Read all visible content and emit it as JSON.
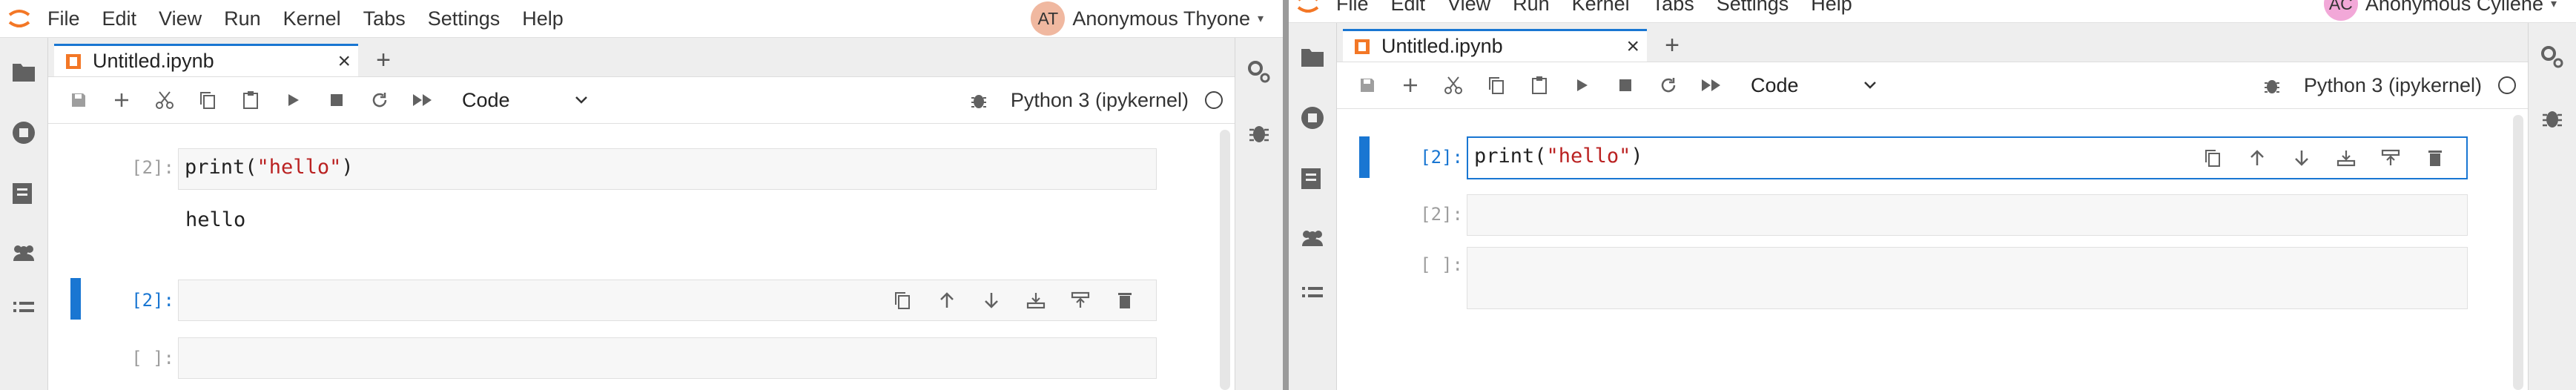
{
  "left": {
    "menu": [
      "File",
      "Edit",
      "View",
      "Run",
      "Kernel",
      "Tabs",
      "Settings",
      "Help"
    ],
    "user": {
      "initials": "AT",
      "name": "Anonymous Thyone",
      "avatar_color": "#f0b8a0"
    },
    "tab": {
      "title": "Untitled.ipynb"
    },
    "toolbar": {
      "cell_type": "Code",
      "kernel": "Python 3 (ipykernel)"
    },
    "cells": [
      {
        "prompt": "[2]:",
        "code_fn": "print(",
        "code_str": "\"hello\"",
        "code_end": ")",
        "output": "hello"
      },
      {
        "prompt": "[2]:"
      },
      {
        "prompt": "[ ]:"
      }
    ]
  },
  "right": {
    "menu": [
      "File",
      "Edit",
      "View",
      "Run",
      "Kernel",
      "Tabs",
      "Settings",
      "Help"
    ],
    "user": {
      "initials": "AC",
      "name": "Anonymous Cyllene",
      "avatar_color": "#f2a8d8"
    },
    "tab": {
      "title": "Untitled.ipynb"
    },
    "toolbar": {
      "cell_type": "Code",
      "kernel": "Python 3 (ipykernel)"
    },
    "cells": [
      {
        "prompt": "[2]:",
        "code_fn": "print(",
        "code_str": "\"hello\"",
        "code_end": ")"
      },
      {
        "prompt": "[2]:"
      },
      {
        "prompt": "[ ]:"
      }
    ]
  },
  "colors": {
    "accent": "#1976d2",
    "string": "#ba2121",
    "logo": "#f37726"
  }
}
